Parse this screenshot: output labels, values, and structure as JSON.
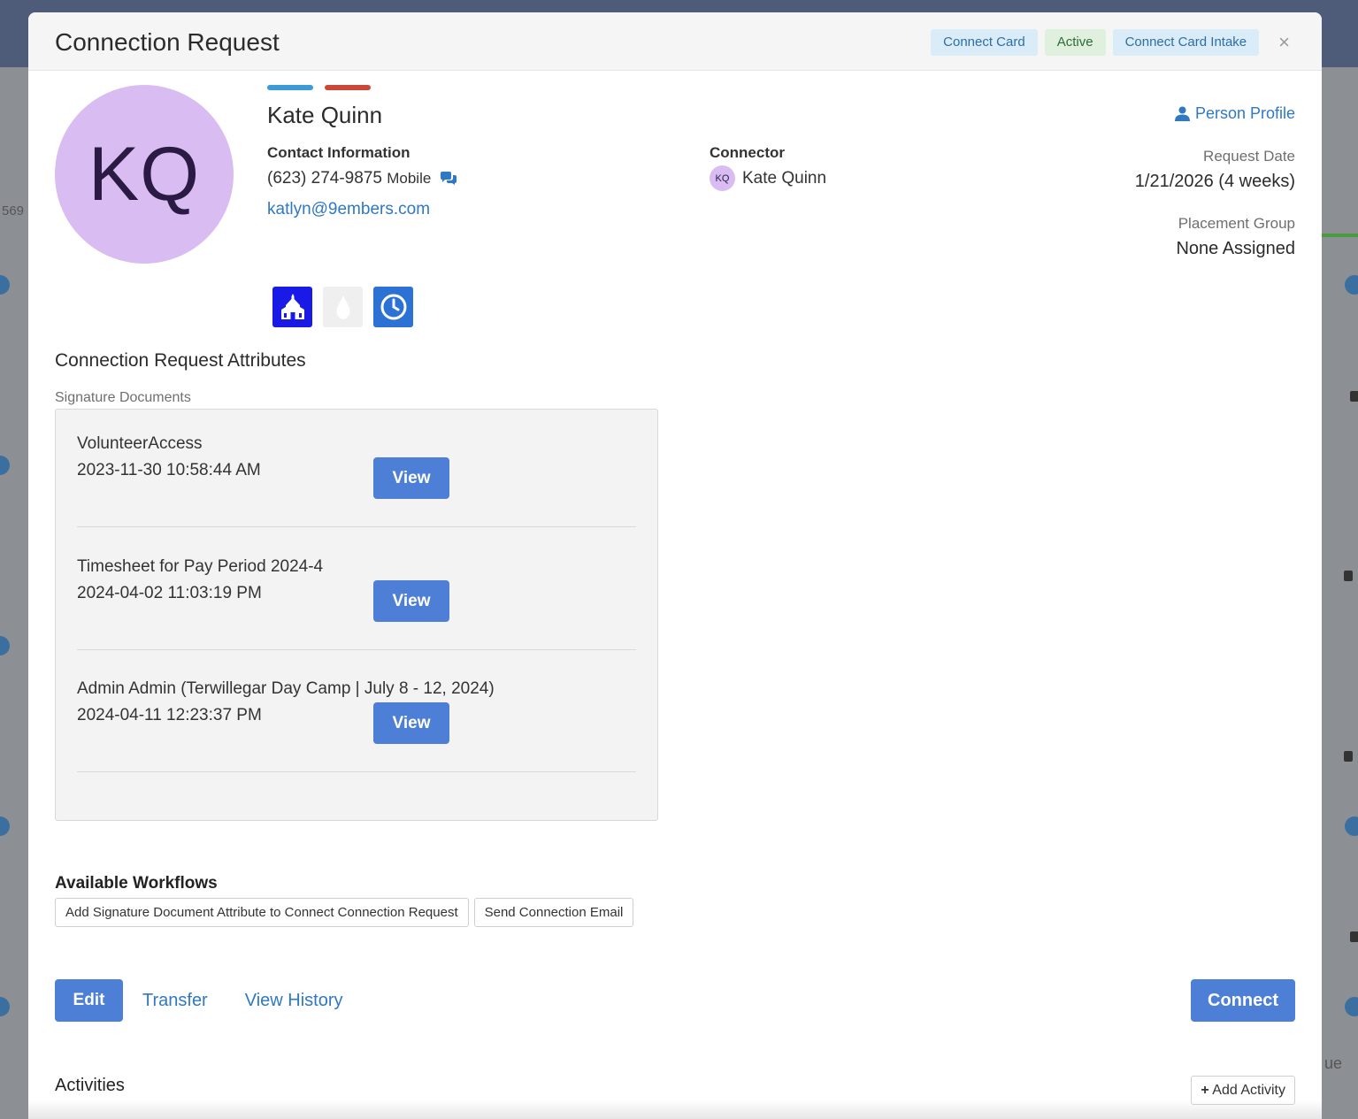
{
  "background": {
    "left_number": "569",
    "right_fragment": "ue"
  },
  "modal": {
    "title": "Connection Request",
    "badges": [
      "Connect Card",
      "Active",
      "Connect Card Intake"
    ],
    "close_icon": "×"
  },
  "person": {
    "initials": "KQ",
    "name": "Kate Quinn",
    "contact_label": "Contact Information",
    "phone": "(623) 274-9875",
    "phone_type": "Mobile",
    "email": "katlyn@9embers.com",
    "connector_label": "Connector",
    "connector_initials": "KQ",
    "connector_name": "Kate Quinn",
    "profile_link": "Person Profile",
    "request_date_label": "Request Date",
    "request_date": "1/21/2026 (4 weeks)",
    "placement_label": "Placement Group",
    "placement_value": "None Assigned"
  },
  "icons": [
    "church-icon",
    "water-drop-icon",
    "clock-icon"
  ],
  "colors": {
    "accent": "#4d7fd6",
    "link": "#2f78c4",
    "avatar": "#d9bdf2",
    "bar_blue": "#3c9ad6",
    "bar_red": "#c9483a"
  },
  "attributes": {
    "title": "Connection Request Attributes",
    "signature_label": "Signature Documents",
    "view_label": "View",
    "documents": [
      {
        "name": "VolunteerAccess",
        "date": "2023-11-30 10:58:44 AM"
      },
      {
        "name": "Timesheet for Pay Period 2024-4",
        "date": "2024-04-02 11:03:19 PM"
      },
      {
        "name": "Admin Admin (Terwillegar Day Camp | July 8 - 12, 2024)",
        "date": "2024-04-11 12:23:37 PM"
      }
    ]
  },
  "workflows": {
    "title": "Available Workflows",
    "items": [
      "Add Signature Document Attribute to Connect Connection Request",
      "Send Connection Email"
    ]
  },
  "actions": {
    "edit": "Edit",
    "transfer": "Transfer",
    "history": "View History",
    "connect": "Connect"
  },
  "activities": {
    "title": "Activities",
    "add": "Add Activity"
  }
}
